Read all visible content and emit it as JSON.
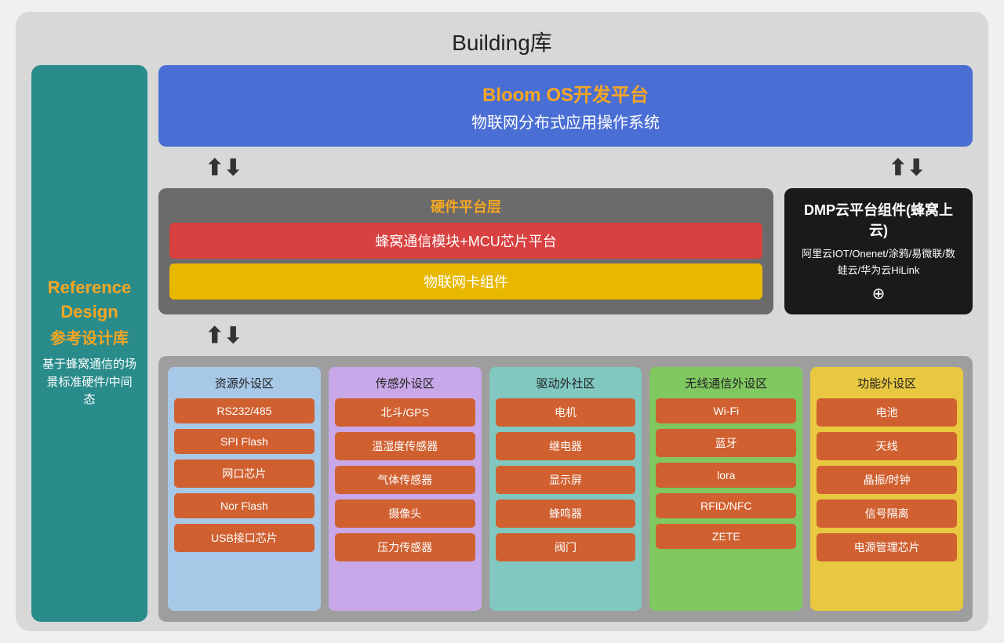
{
  "title": "Building库",
  "sidebar": {
    "title_en_line1": "Reference",
    "title_en_line2": "Design",
    "title_cn": "参考设计库",
    "desc": "基于蜂窝通信的场景标准硬件/中间态"
  },
  "os_platform": {
    "title": "Bloom OS开发平台",
    "subtitle": "物联网分布式应用操作系统"
  },
  "hardware": {
    "section_title": "硬件平台层",
    "layer_red": "蜂窝通信模块+MCU芯片平台",
    "layer_yellow": "物联网卡组件"
  },
  "dmp_cloud": {
    "title": "DMP云平台组件(蜂窝上云)",
    "desc": "阿里云IOT/Onenet/涂鸦/易微联/数蛙云/华为云HiLink",
    "plus": "⊕"
  },
  "peripherals": {
    "columns": [
      {
        "title": "资源外设区",
        "color": "col-resources",
        "items": [
          "RS232/485",
          "SPI Flash",
          "网口芯片",
          "Nor Flash",
          "USB接口芯片"
        ]
      },
      {
        "title": "传感外设区",
        "color": "col-sensing",
        "items": [
          "北斗/GPS",
          "温湿度传感器",
          "气体传感器",
          "摄像头",
          "压力传感器"
        ]
      },
      {
        "title": "驱动外社区",
        "color": "col-drive",
        "items": [
          "电机",
          "继电器",
          "显示屏",
          "蜂鸣器",
          "阀门"
        ]
      },
      {
        "title": "无线通信外设区",
        "color": "col-wireless",
        "items": [
          "Wi-Fi",
          "蓝牙",
          "lora",
          "RFID/NFC",
          "ZETE"
        ]
      },
      {
        "title": "功能外设区",
        "color": "col-function",
        "items": [
          "电池",
          "天线",
          "晶振/时钟",
          "信号隔离",
          "电源管理芯片"
        ]
      }
    ]
  }
}
